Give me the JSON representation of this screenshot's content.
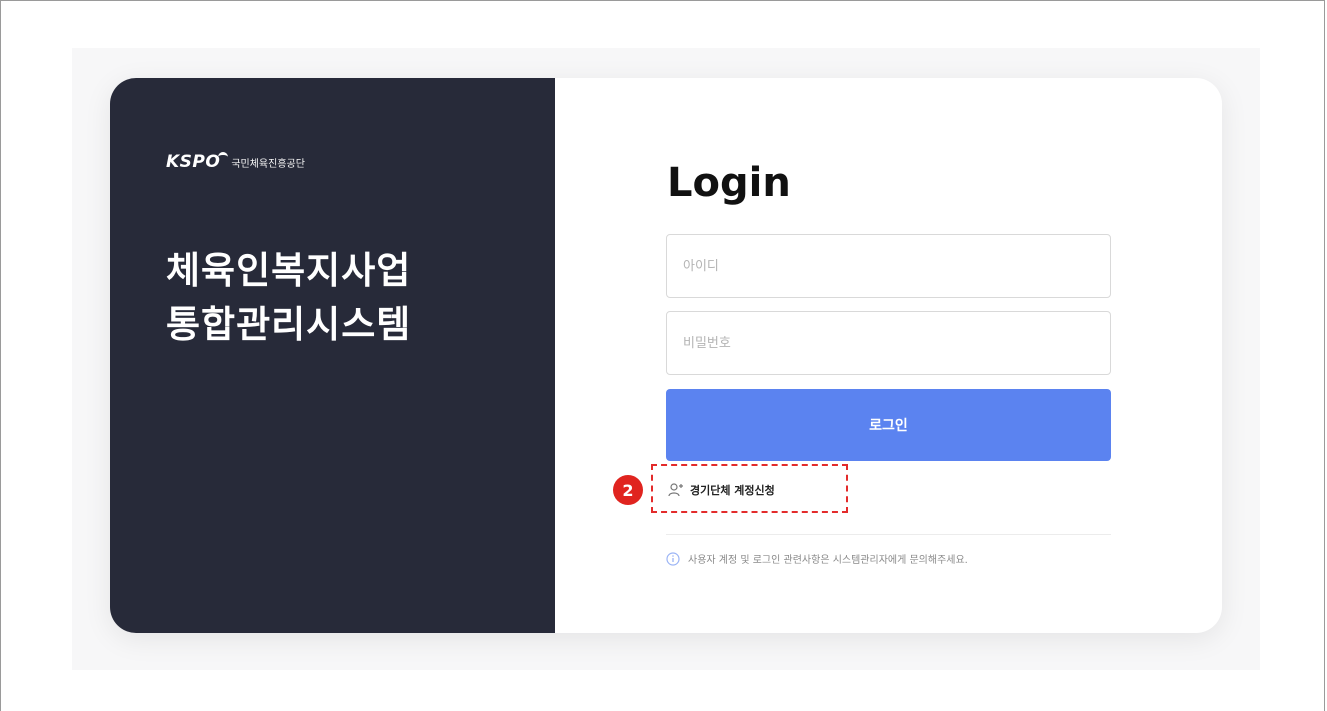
{
  "brand": {
    "logo_mark": "KSPO",
    "org_name": "국민체육진흥공단"
  },
  "system": {
    "title_line1": "체육인복지사업",
    "title_line2": "통합관리시스템"
  },
  "login": {
    "heading": "Login",
    "id_placeholder": "아이디",
    "pw_placeholder": "비밀번호",
    "button_label": "로그인",
    "signup_label": "경기단체 계정신청",
    "notice": "사용자 계정 및 로그인 관련사항은 시스템관리자에게 문의해주세요."
  },
  "annotation": {
    "badge": "2"
  },
  "colors": {
    "left_panel": "#272a39",
    "primary_button": "#5b83f0",
    "annotation_red": "#e0241f"
  }
}
